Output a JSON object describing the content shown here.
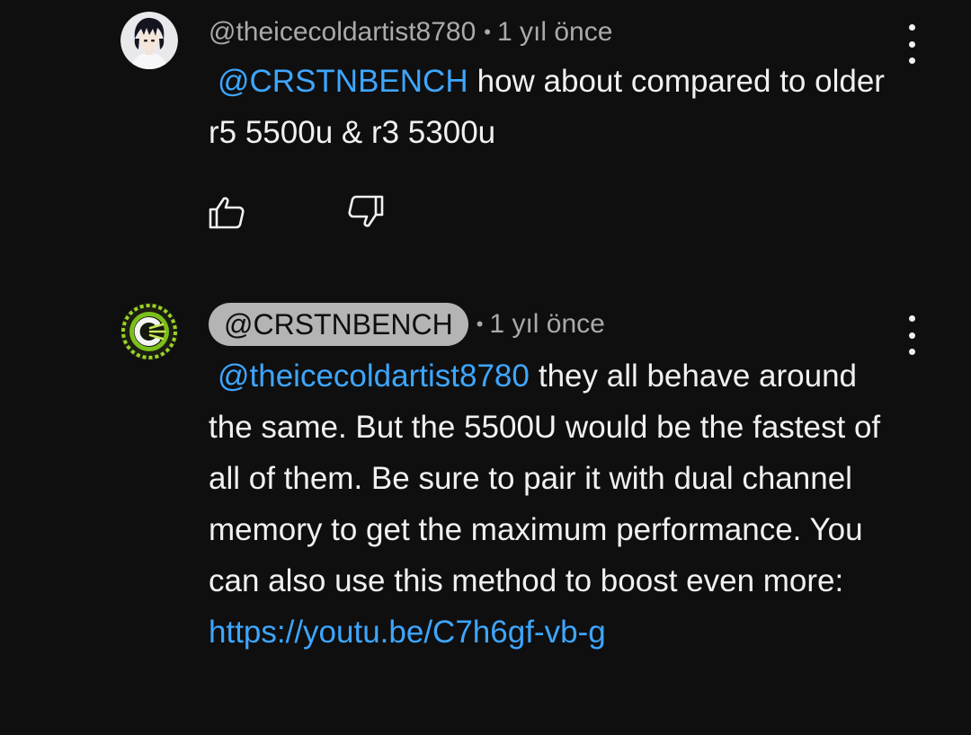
{
  "comments": [
    {
      "author": "@theicecoldartist8780",
      "separator": "•",
      "time": "1 yıl önce",
      "mention": "@CRSTNBENCH",
      "text": "how about compared to older r5 5500u & r3 5300u",
      "avatar_icon": "anime-character-avatar"
    },
    {
      "author": "@CRSTNBENCH",
      "separator": "•",
      "time": "1 yıl önce",
      "mention": "@theicecoldartist8780",
      "text": "they all behave around the same. But the 5500U would be the fastest of all of them. Be sure to pair it with dual channel memory to get the maximum performance. You can also use this method to boost even more:",
      "link": "https://youtu.be/C7h6gf-vb-g",
      "avatar_icon": "crstnbench-logo-avatar"
    }
  ],
  "colors": {
    "background": "#0f0f0f",
    "text": "#f1f1f1",
    "meta": "#aaaaaa",
    "mention": "#3ea6ff",
    "author_pill": "#b4b4b4",
    "logo_green": "#9bd22a"
  }
}
